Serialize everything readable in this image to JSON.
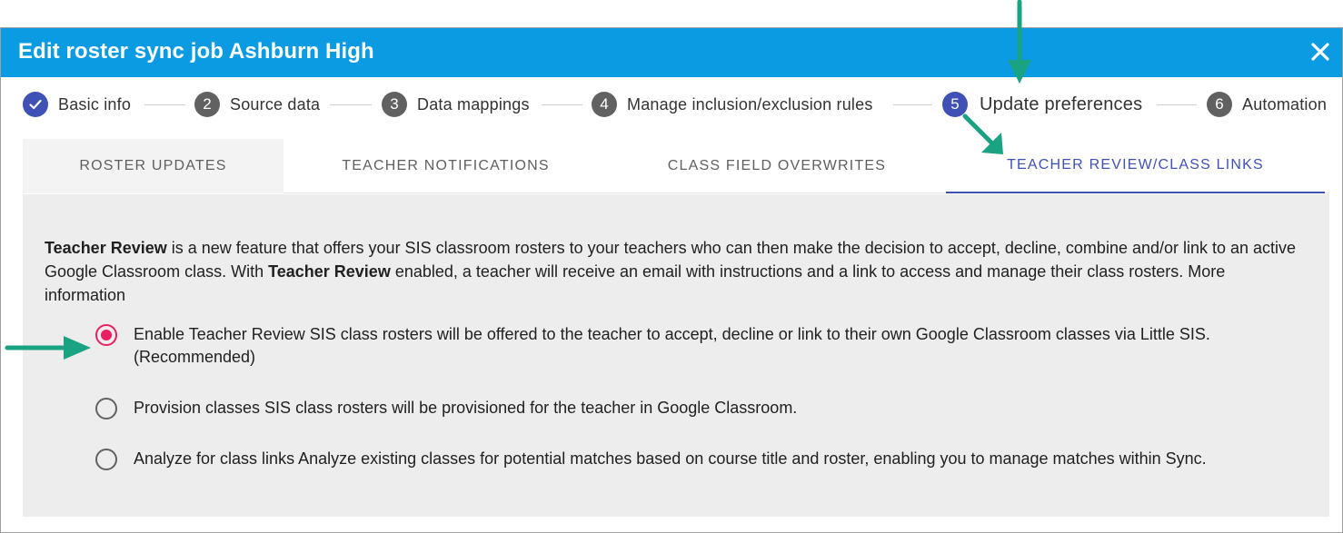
{
  "dialog": {
    "title": "Edit roster sync job Ashburn High",
    "close_icon": "close-icon"
  },
  "stepper": {
    "steps": [
      {
        "number": "✓",
        "label": "Basic info",
        "state": "done"
      },
      {
        "number": "2",
        "label": "Source data",
        "state": "pending"
      },
      {
        "number": "3",
        "label": "Data mappings",
        "state": "pending"
      },
      {
        "number": "4",
        "label": "Manage inclusion/exclusion rules",
        "state": "pending"
      },
      {
        "number": "5",
        "label": "Update preferences",
        "state": "active"
      },
      {
        "number": "6",
        "label": "Automation",
        "state": "pending"
      }
    ]
  },
  "tabs": [
    {
      "label": "ROSTER UPDATES"
    },
    {
      "label": "TEACHER NOTIFICATIONS"
    },
    {
      "label": "CLASS FIELD OVERWRITES"
    },
    {
      "label": "TEACHER REVIEW/CLASS LINKS",
      "selected": true
    }
  ],
  "panel": {
    "desc_bold_1": "Teacher Review",
    "desc_text_1": " is a new feature that offers your SIS classroom rosters to your teachers who can then make the decision to accept, decline, combine and/or link to an active Google Classroom class. With ",
    "desc_bold_2": "Teacher Review",
    "desc_text_2": " enabled, a teacher will receive an email with instructions and a link to access and manage their class rosters. More information",
    "options": [
      {
        "text": "Enable Teacher Review SIS class rosters will be offered to the teacher to accept, decline or link to their own Google Classroom classes via Little SIS. (Recommended)",
        "checked": true
      },
      {
        "text": "Provision classes SIS class rosters will be provisioned for the teacher in Google Classroom.",
        "checked": false
      },
      {
        "text": "Analyze for class links Analyze existing classes for potential matches based on course title and roster, enabling you to manage matches within Sync.",
        "checked": false
      }
    ]
  },
  "colors": {
    "titlebar": "#0b9be2",
    "accent": "#3f51b5",
    "radio_checked": "#e91e63",
    "annotation_arrow": "#1aa383"
  }
}
